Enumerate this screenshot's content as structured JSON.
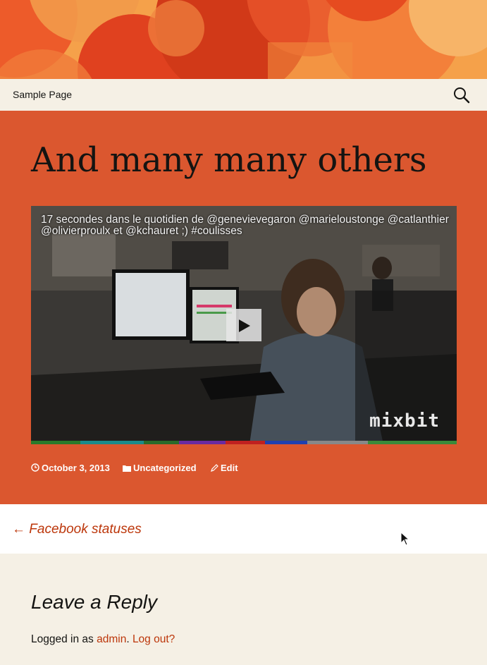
{
  "header": {
    "nav_items": [
      "Sample Page"
    ],
    "search_icon": "search-icon"
  },
  "post": {
    "title": "And many many others",
    "video": {
      "caption": "17 secondes dans le quotidien de @genevievegaron @marieloustonge @catlanthier @olivierproulx et @kchauret ;) #coulisses",
      "brand": "mixbit",
      "play_icon": "play-icon"
    },
    "meta": {
      "date": "October 3, 2013",
      "category": "Uncategorized",
      "edit": "Edit"
    }
  },
  "post_navigation": {
    "previous": "Facebook statuses",
    "arrow": "←"
  },
  "comments": {
    "title": "Leave a Reply",
    "logged_in_prefix": "Logged in as",
    "user": "admin",
    "logout": "Log out?"
  },
  "colors": {
    "post_bg": "#db572f",
    "nav_bg": "#f5f0e5",
    "link": "#bc360a"
  }
}
